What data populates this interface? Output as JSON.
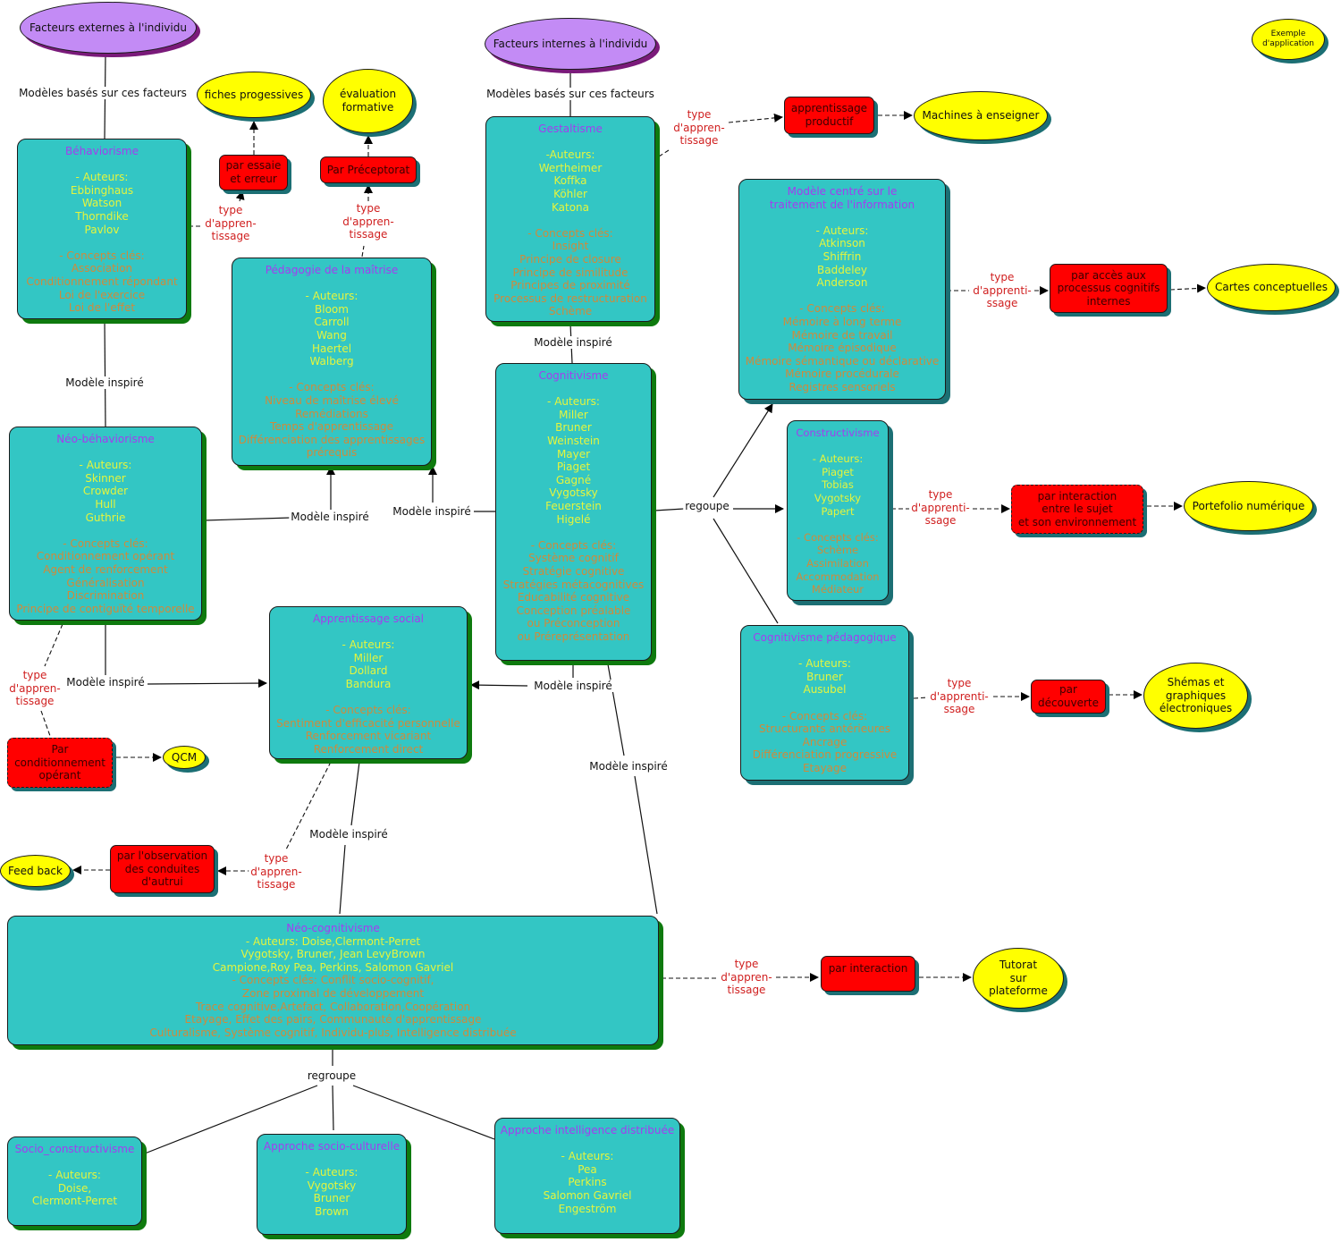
{
  "roots": {
    "external": "Facteurs externes à l'individu",
    "internal": "Facteurs internes à l'individu",
    "legend": "Exemple\nd'application"
  },
  "links": {
    "based_on": "Modèles basés sur ces facteurs",
    "inspired": "Modèle inspiré",
    "groups": "regoupe",
    "groups2": "regroupe",
    "type_a": "type\nd'appren-\ntissage",
    "type_b": "type\nd'apprenti-\nssage"
  },
  "concepts": {
    "behaviorisme": {
      "title": "Béhaviorisme",
      "authors": "- Auteurs:\nEbbinghaus\nWatson\nThorndike\nPavlov",
      "concepts": "- Concepts clés:\nAssociation\nConditionnement répondant\nLoi de l'exercice\nLoi de l'effet"
    },
    "maitrise": {
      "title": "Pédagogie de la maîtrise",
      "authors": "- Auteurs:\nBloom\nCarroll\nWang\nHaertel\nWalberg",
      "concepts": "- Concepts clés:\nNiveau de maîtrise  élevé\nRemédiations\nTemps d'apprentissage\nDifférenciation des apprentissages\nprérequis"
    },
    "gestaltisme": {
      "title": "Gestaltisme",
      "authors": "-Auteurs:\nWertheimer\nKoffka\nKöhler\nKatona",
      "concepts": "- Concepts clés:\nInsight\nPrincipe de closure\nPrincipe de similitude\nPrincipes de proximité\nProcessus de restructuration\nSchème"
    },
    "traitement": {
      "title": "Modèle centré sur le\ntraitement de l'information",
      "authors": "- Auteurs:\nAtkinson\nShiffrin\nBaddeley\nAnderson",
      "concepts": "- Concepts clés:\nMémoire à long terme\nMémoire de travail\nMémoire épisodique\nMémoire sémantique ou déclarative\nMémoire procédurale\nRegistres sensoriels"
    },
    "neobehaviorisme": {
      "title": "Néo-béhaviorisme",
      "authors": "- Auteurs:\nSkinner\nCrowder\nHull\nGuthrie",
      "concepts": "- Concepts clés:\nConditionnement opérant\nAgent de renforcement\nGénéralisation\nDiscrimination\nPrincipe de contiguïté temporelle"
    },
    "cognitivisme": {
      "title": "Cognitivisme",
      "authors": "- Auteurs:\nMiller\nBruner\nWeinstein\nMayer\nPiaget\nGagné\nVygotsky\nFeuerstein\nHigelé",
      "concepts": "- Concepts clés:\nSystème cognitif\nStratégie cognitive\nStratégies métacognitives\nEducabilité cognitive\nConception préalable\nou Préconception\nou Préreprésentation"
    },
    "constructivisme": {
      "title": "Constructivisme",
      "authors": "- Auteurs:\nPiaget\nTobias\nVygotsky\nPapert",
      "concepts": "- Concepts clés:\nSchème\nAssimilation\nAccommodation\nMédiateur"
    },
    "cogpeda": {
      "title": "Cognitivisme pédagogique",
      "authors": "- Auteurs:\nBruner\nAusubel",
      "concepts": "- Concepts clés:\nStructurants antérieures\nAncrage\nDifférenciation progressive\nEtayage"
    },
    "social": {
      "title": "Apprentissage social",
      "authors": "- Auteurs:\nMiller\nDollard\nBandura",
      "concepts": "- Concepts clés:\nSentiment d'efficacité personnelle\nRenforcement vicariant\nRenforcement direct"
    },
    "neocog": {
      "title": "Néo-cognitivisme",
      "authors": "- Auteurs: Doise,Clermont-Perret\nVygotsky, Bruner, Jean LevyBrown\nCampione,Roy Pea, Perkins, Salomon Gavriel",
      "concepts": "- Concepts clés: Conflit socio-cognitif,\nZone proximal de développement\nTrace cognitive,Artefact, Collaboration,Coopération\nEtayage, Effet des pairs, Communauté d'apprentissage\nCulturalisme, Système cognitif, Individu-plus, Intelligence distribuée"
    },
    "socioconst": {
      "title": "Socio_constructivisme",
      "authors": "- Auteurs:\nDoise,\nClermont-Perret"
    },
    "socioculturelle": {
      "title": "Approche socio-culturelle",
      "authors": "- Auteurs:\nVygotsky\nBruner\nBrown"
    },
    "distribuee": {
      "title": "Approche intelligence distribuée",
      "authors": "- Auteurs:\nPea\nPerkins\nSalomon Gavriel\nEngeström"
    }
  },
  "learning_types": {
    "essai": "par essaie\net erreur",
    "preceptorat": "Par Préceptorat",
    "productif": "apprentissage\nproductif",
    "acces": "par accès aux\nprocessus cognitifs\ninternes",
    "interaction_env": "par interaction\nentre le sujet\net son environnement",
    "decouverte": "par\ndécouverte",
    "conditionnement": "Par\nconditionnement\nopérant",
    "observation": "par l'observation\ndes conduites\nd'autrui",
    "interaction": "par interaction"
  },
  "applications": {
    "fiches": "fiches progessives",
    "evaluation": "évaluation\nformative",
    "machines": "Machines à enseigner",
    "cartes": "Cartes conceptuelles",
    "portefolio": "Portefolio numérique",
    "schemas": "Shémas et\ngraphiques\nélectroniques",
    "qcm": "QCM",
    "feedback": "Feed back",
    "tutorat": "Tutorat\nsur\nplateforme"
  },
  "colors": {
    "concept_fill": "#33c6c4",
    "concept_title": "#a43cf0",
    "authors": "#e6f53c",
    "concepts": "#d08a3a",
    "learning_type": "#ff0000",
    "application": "#ffff00",
    "root": "#c38bf5",
    "link_label_red": "#d02020"
  }
}
